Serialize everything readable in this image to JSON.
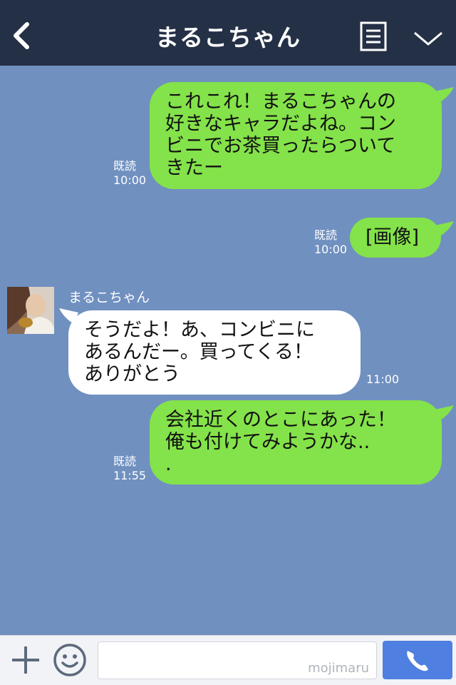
{
  "header": {
    "title": "まるこちゃん",
    "back_icon": "chevron-left-icon",
    "menu_icon": "list-icon",
    "collapse_icon": "chevron-down-icon"
  },
  "messages": [
    {
      "direction": "out",
      "text": "これこれ！まるこちゃんの\n好きなキャラだよね。コン\nビニでお茶買ったらついて\nきたー",
      "read": "既読",
      "time": "10:00"
    },
    {
      "direction": "out",
      "text": "[画像]",
      "read": "既読",
      "time": "10:00"
    },
    {
      "direction": "in",
      "sender": "まるこちゃん",
      "text": "そうだよ！あ、コンビニに\nあるんだー。買ってくる！\nありがとう",
      "time": "11:00"
    },
    {
      "direction": "out",
      "text": "会社近くのとこにあった！\n俺も付けてみようかな..\n.",
      "read": "既読",
      "time": "11:55"
    }
  ],
  "footer": {
    "plus_icon": "plus-icon",
    "sticker_icon": "smiley-icon",
    "input_value": "",
    "watermark": "mojimaru",
    "call_icon": "phone-icon"
  },
  "colors": {
    "header_bg": "#243046",
    "chat_bg": "#7090c0",
    "outgoing_bubble": "#84e24a",
    "incoming_bubble": "#ffffff",
    "call_button": "#4f7fe0"
  }
}
